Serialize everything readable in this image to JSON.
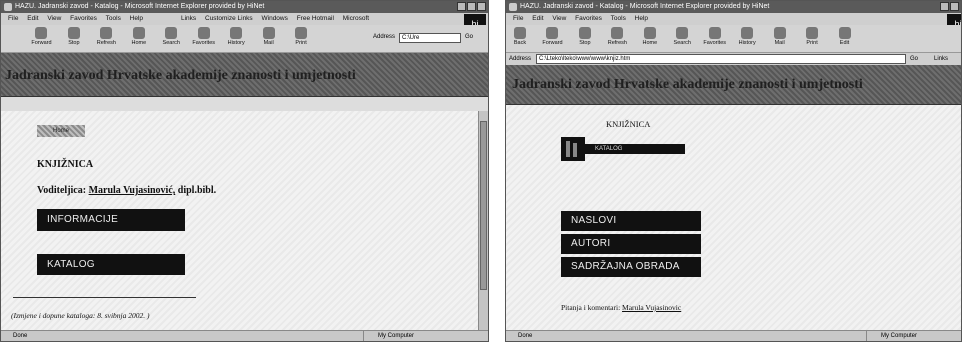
{
  "left_window": {
    "title": "HAZU. Jadranski zavod - Katalog - Microsoft Internet Explorer provided by HiNet",
    "menu": [
      "File",
      "Edit",
      "View",
      "Favorites",
      "Tools",
      "Help"
    ],
    "links_bar": [
      "Links",
      "Customize Links",
      "Windows",
      "Free Hotmail",
      "Microsoft"
    ],
    "address_label": "Address",
    "address_value": "C:\\Ure",
    "go_label": "Go",
    "toolbar": [
      "Forward",
      "Stop",
      "Refresh",
      "Home",
      "Search",
      "Favorites",
      "History",
      "Mail",
      "Print"
    ],
    "banner_title": "Jadranski zavod Hrvatske akademije znanosti i umjetnosti",
    "logo_text": "Home",
    "heading": "KNJIŽNICA",
    "leader_label": "Voditeljica:",
    "leader_name": "Marula Vujasinović,",
    "leader_suffix": "dipl.bibl.",
    "buttons": [
      "INFORMACIJE",
      "KATALOG"
    ],
    "footer_note": "(Izmjene i dopune kataloga: 8. svibnja 2002. )",
    "status_left": "Done",
    "status_right": "My Computer"
  },
  "right_window": {
    "title": "HAZU. Jadranski zavod - Katalog - Microsoft Internet Explorer provided by HiNet",
    "menu": [
      "File",
      "Edit",
      "View",
      "Favorites",
      "Tools",
      "Help"
    ],
    "toolbar": [
      "Back",
      "Forward",
      "Stop",
      "Refresh",
      "Home",
      "Search",
      "Favorites",
      "History",
      "Mail",
      "Print",
      "Edit"
    ],
    "address_label": "Address",
    "address_value": "C:\\Lteko\\lteko\\www\\www\\knjiz.htm",
    "go_label": "Go",
    "links_label": "Links",
    "banner_title": "Jadranski zavod Hrvatske akademije znanosti i umjetnosti",
    "heading": "KNJIŽNICA",
    "katalog_label": "KATALOG",
    "buttons": [
      "NASLOVI",
      "AUTORI",
      "SADRŽAJNA OBRADA"
    ],
    "contact_label": "Pitanja i komentari:",
    "contact_name": "Marula Vujasinovic",
    "status_left": "Done",
    "status_right": "My Computer"
  },
  "throbber_text": "hi"
}
